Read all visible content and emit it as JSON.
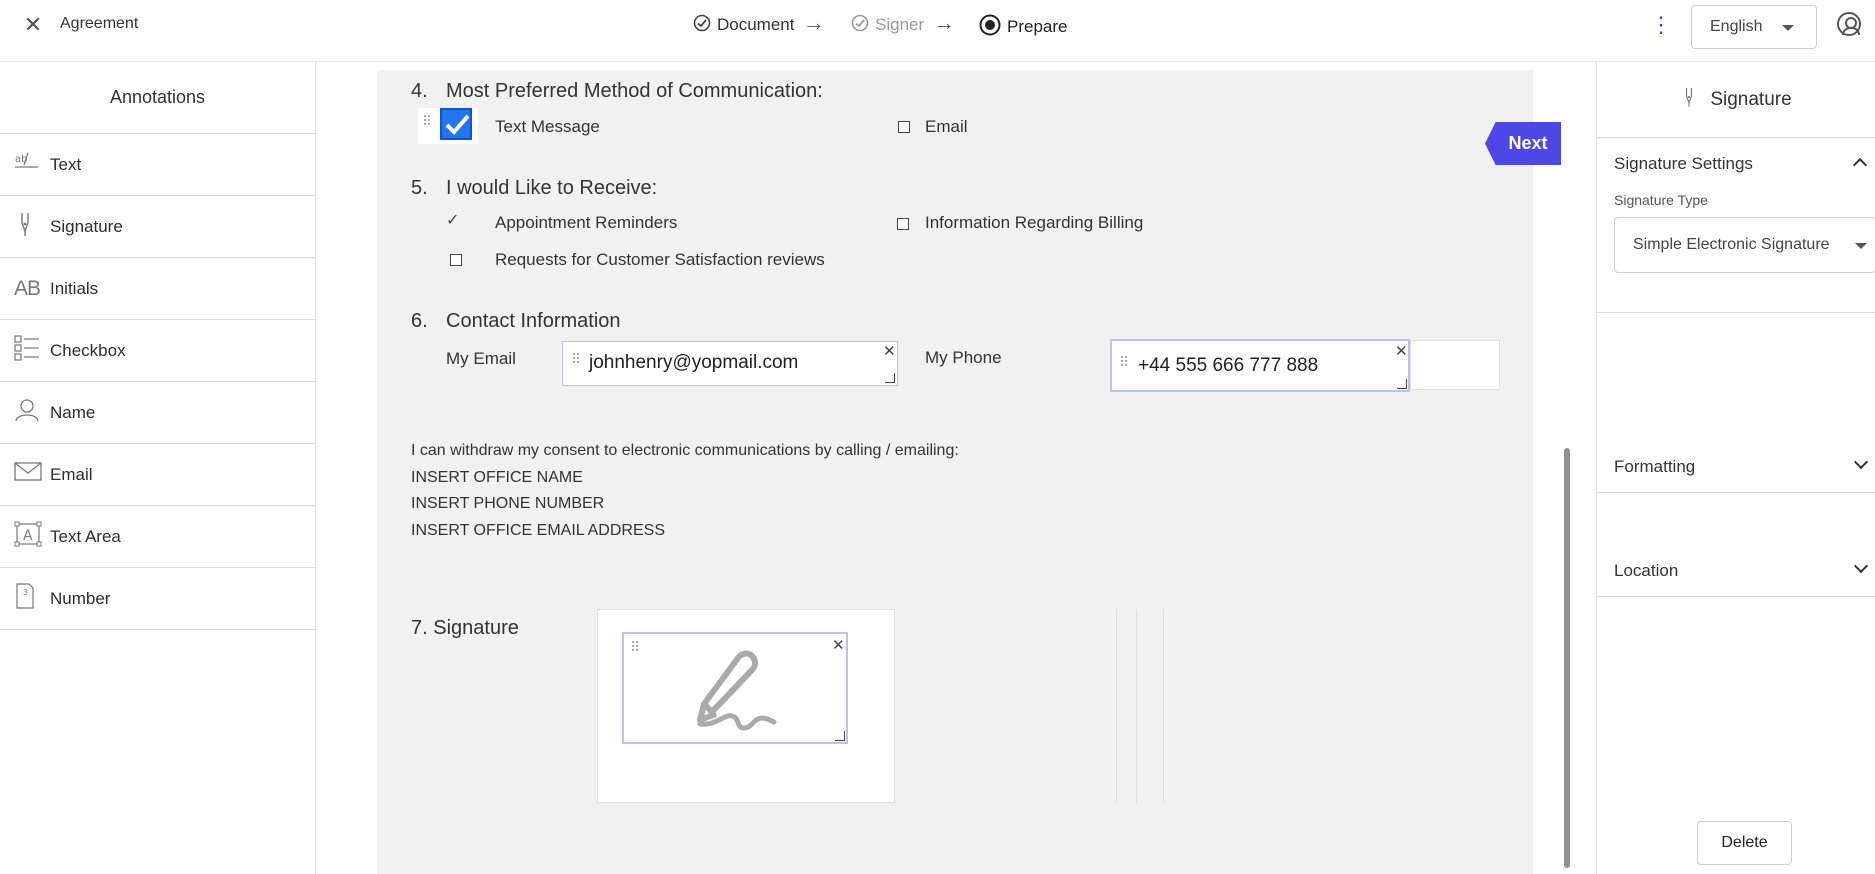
{
  "topbar": {
    "close_icon": "close-icon",
    "title": "Agreement",
    "steps": [
      {
        "label": "Document",
        "icon": "check-circle-icon",
        "state": "done"
      },
      {
        "label": "Signer",
        "icon": "check-circle-icon",
        "state": "done-muted"
      },
      {
        "label": "Prepare",
        "icon": "radio-selected-icon",
        "state": "current"
      }
    ],
    "language": "English"
  },
  "annotations": {
    "title": "Annotations",
    "items": [
      {
        "label": "Text",
        "icon": "text-icon"
      },
      {
        "label": "Signature",
        "icon": "signature-pen-icon"
      },
      {
        "label": "Initials",
        "icon": "initials-icon"
      },
      {
        "label": "Checkbox",
        "icon": "checkbox-list-icon"
      },
      {
        "label": "Name",
        "icon": "person-icon"
      },
      {
        "label": "Email",
        "icon": "envelope-icon"
      },
      {
        "label": "Text Area",
        "icon": "text-area-icon"
      },
      {
        "label": "Number",
        "icon": "number-icon"
      }
    ]
  },
  "document": {
    "sec4": {
      "num": "4.",
      "title": "Most Preferred Method of Communication:",
      "opt1": "Text Message",
      "opt2": "Email"
    },
    "sec5": {
      "num": "5.",
      "title": "I would Like to Receive:",
      "opt1": "Appointment Reminders",
      "opt2": "Information Regarding Billing",
      "opt3": "Requests for Customer Satisfaction reviews"
    },
    "sec6": {
      "num": "6.",
      "title": "Contact Information",
      "email_label": "My Email",
      "email_value": "johnhenry@yopmail.com",
      "phone_label": "My Phone",
      "phone_value": "+44 555 666 777 888"
    },
    "consent": {
      "line1": "I can withdraw my consent to electronic communications by calling / emailing:",
      "line2": "INSERT OFFICE NAME",
      "line3": "INSERT PHONE NUMBER",
      "line4": "INSERT OFFICE EMAIL ADDRESS"
    },
    "sec7": {
      "title": "7. Signature"
    },
    "next_label": "Next"
  },
  "right_panel": {
    "title": "Signature",
    "settings_title": "Signature Settings",
    "sig_type_label": "Signature Type",
    "sig_type_value": "Simple Electronic Signature",
    "formatting": "Formatting",
    "location": "Location",
    "delete_label": "Delete"
  },
  "colors": {
    "accent": "#4c47e6",
    "checkbox": "#2277ee",
    "field_border": "#b8c2ee"
  }
}
